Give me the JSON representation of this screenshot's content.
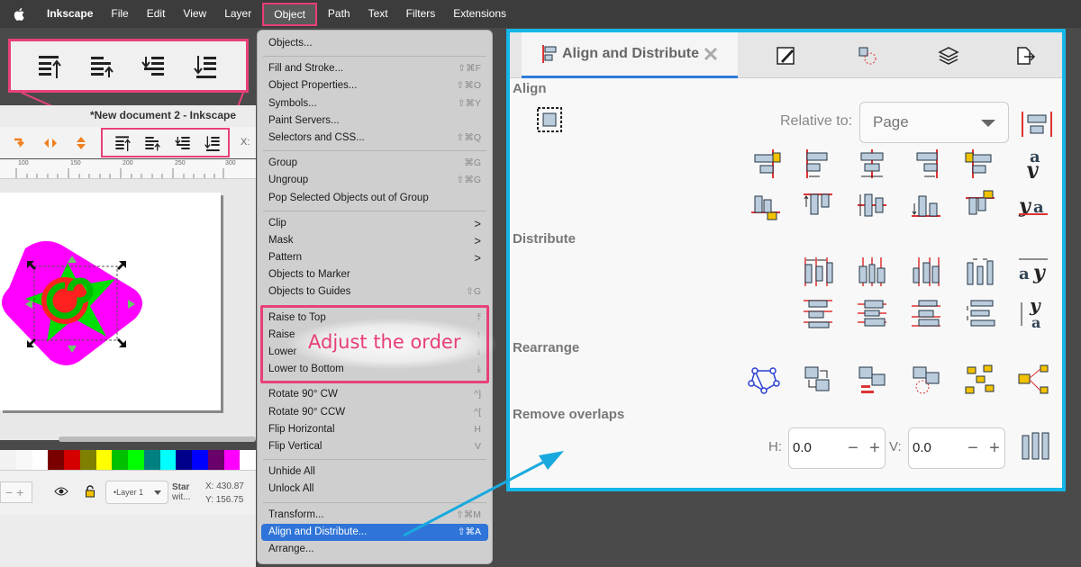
{
  "menubar": {
    "app_name": "Inkscape",
    "items": [
      "File",
      "Edit",
      "View",
      "Layer",
      "Object",
      "Path",
      "Text",
      "Filters",
      "Extensions"
    ]
  },
  "document": {
    "title": "*New document 2 - Inkscape",
    "ruler_ticks": [
      "100",
      "150",
      "200",
      "250",
      "300"
    ],
    "coord_label": "X:"
  },
  "statusbar": {
    "layer": "•Layer 1",
    "object_line1": "Star",
    "object_line2": "wit...",
    "x_label": "X:",
    "x_value": "430.87",
    "y_label": "Y:",
    "y_value": "156.75"
  },
  "palette": [
    "#f2f2f2",
    "#f8f8f8",
    "#ffffff",
    "#7a0000",
    "#d40000",
    "#808000",
    "#ffff00",
    "#00c000",
    "#00ff00",
    "#008080",
    "#00ffff",
    "#00008b",
    "#0000ff",
    "#6a006a",
    "#ff00ff",
    "#ffffff"
  ],
  "menu": {
    "groups": [
      [
        {
          "label": "Objects...",
          "shortcut": ""
        }
      ],
      [
        {
          "label": "Fill and Stroke...",
          "shortcut": "⇧⌘F"
        },
        {
          "label": "Object Properties...",
          "shortcut": "⇧⌘O"
        },
        {
          "label": "Symbols...",
          "shortcut": "⇧⌘Y"
        },
        {
          "label": "Paint Servers...",
          "shortcut": ""
        },
        {
          "label": "Selectors and CSS...",
          "shortcut": "⇧⌘Q"
        }
      ],
      [
        {
          "label": "Group",
          "shortcut": "⌘G"
        },
        {
          "label": "Ungroup",
          "shortcut": "⇧⌘G"
        },
        {
          "label": "Pop Selected Objects out of Group",
          "shortcut": ""
        }
      ],
      [
        {
          "label": "Clip",
          "shortcut": ">"
        },
        {
          "label": "Mask",
          "shortcut": ">"
        },
        {
          "label": "Pattern",
          "shortcut": ">"
        },
        {
          "label": "Objects to Marker",
          "shortcut": ""
        },
        {
          "label": "Objects to Guides",
          "shortcut": "⇧G"
        }
      ],
      [
        {
          "label": "Raise to Top",
          "shortcut": "⤒"
        },
        {
          "label": "Raise",
          "shortcut": "↑"
        },
        {
          "label": "Lower",
          "shortcut": "↓"
        },
        {
          "label": "Lower to Bottom",
          "shortcut": "⤓"
        }
      ],
      [
        {
          "label": "Rotate 90° CW",
          "shortcut": "^]"
        },
        {
          "label": "Rotate 90° CCW",
          "shortcut": "^["
        },
        {
          "label": "Flip Horizontal",
          "shortcut": "H"
        },
        {
          "label": "Flip Vertical",
          "shortcut": "V"
        }
      ],
      [
        {
          "label": "Unhide All",
          "shortcut": ""
        },
        {
          "label": "Unlock All",
          "shortcut": ""
        }
      ],
      [
        {
          "label": "Transform...",
          "shortcut": "⇧⌘M"
        },
        {
          "label": "Align and Distribute...",
          "shortcut": "⇧⌘A",
          "selected": true
        },
        {
          "label": "Arrange...",
          "shortcut": ""
        }
      ]
    ],
    "annotation": "Adjust the order"
  },
  "dialog": {
    "tab_title": "Align and Distribute",
    "sections": {
      "align": "Align",
      "distribute": "Distribute",
      "rearrange": "Rearrange",
      "remove_overlaps": "Remove overlaps"
    },
    "relative_to_label": "Relative to:",
    "relative_to_value": "Page",
    "h_label": "H:",
    "h_value": "0.0",
    "v_label": "V:",
    "v_value": "0.0"
  },
  "colors": {
    "highlight_pink": "#e8417a",
    "dialog_border": "#15b6e8",
    "menu_selected": "#2f74d8",
    "arrow": "#1aa9de"
  }
}
